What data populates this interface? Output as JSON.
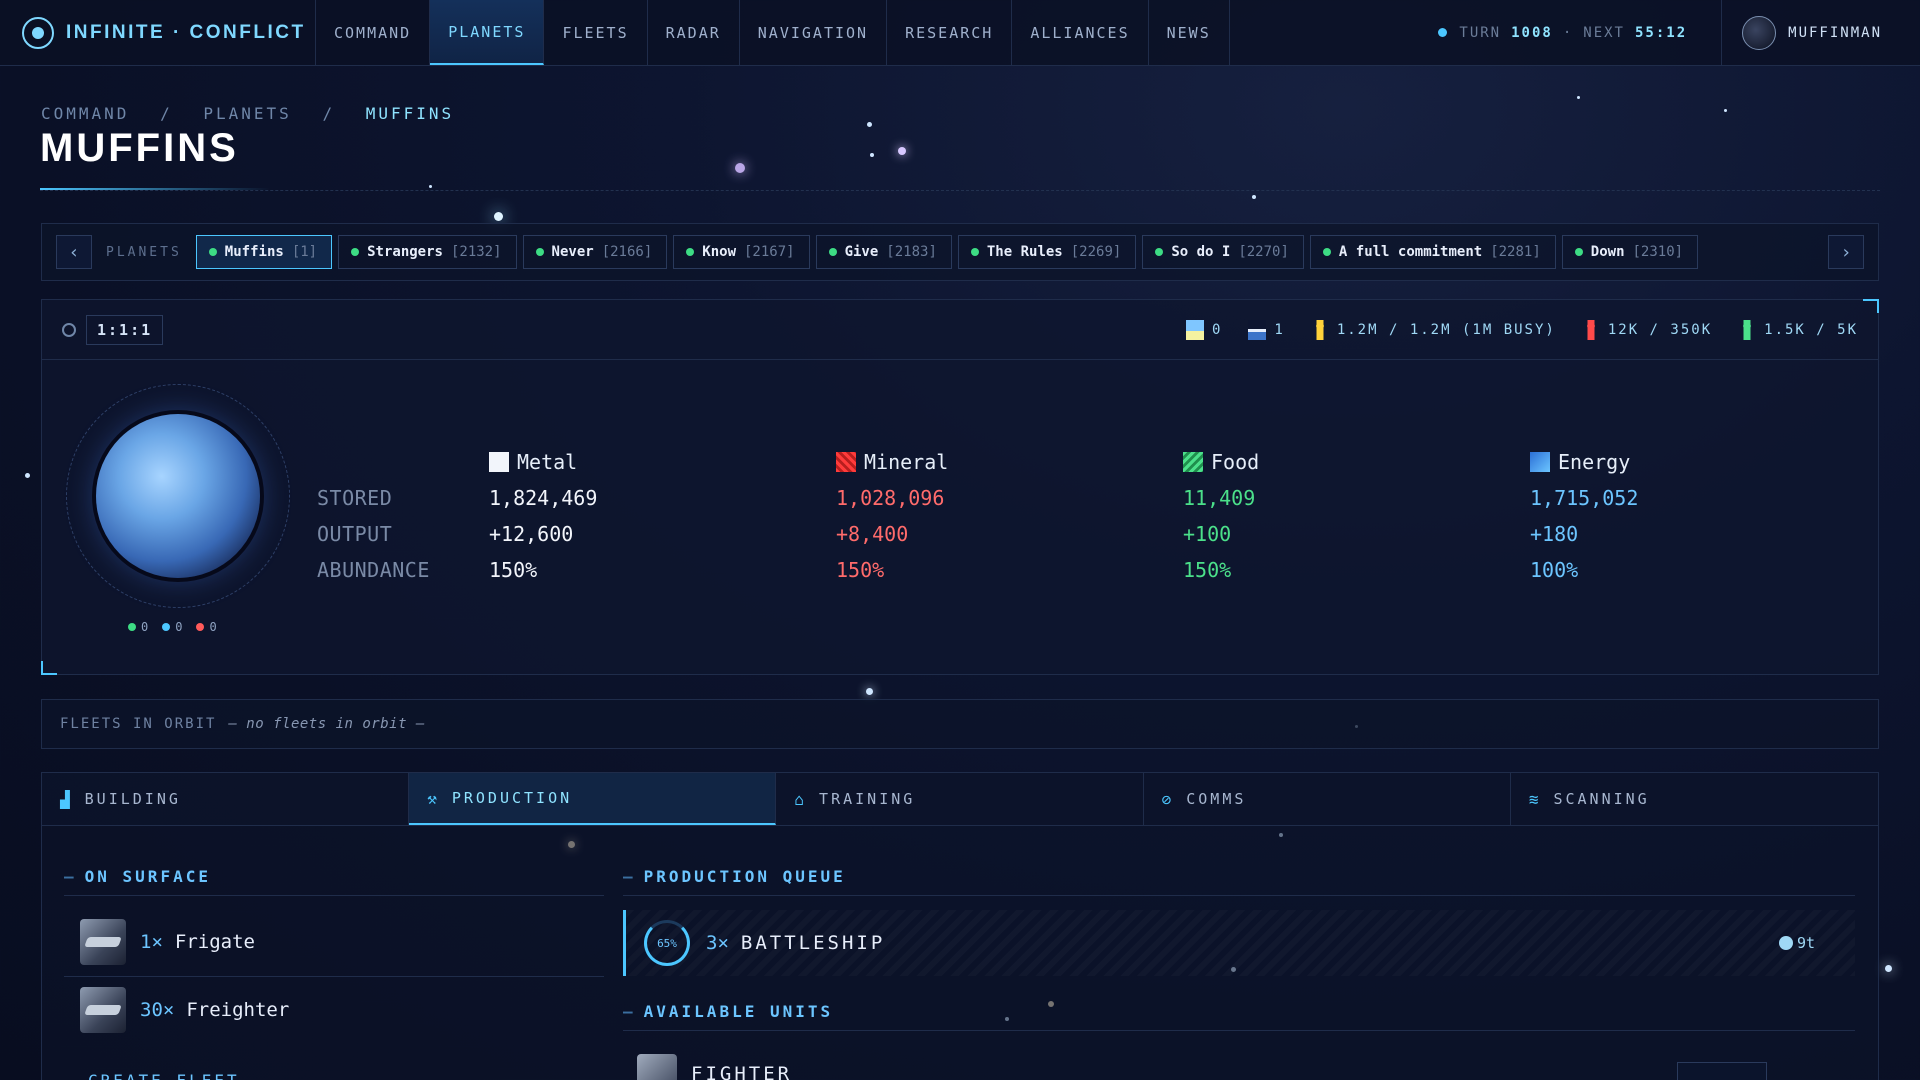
{
  "app": {
    "title": "INFINITE · CONFLICT"
  },
  "nav": {
    "items": [
      "COMMAND",
      "PLANETS",
      "FLEETS",
      "RADAR",
      "NAVIGATION",
      "RESEARCH",
      "ALLIANCES",
      "NEWS"
    ],
    "active": "PLANETS"
  },
  "turn": {
    "label": "TURN",
    "value": "1008",
    "sep": "·",
    "next_label": "NEXT",
    "next_value": "55:12"
  },
  "user": {
    "name": "MUFFINMAN"
  },
  "breadcrumb": {
    "items": [
      "COMMAND",
      "PLANETS",
      "MUFFINS"
    ],
    "sep": "/"
  },
  "page_title": "MUFFINS",
  "planet_strip": {
    "label": "PLANETS",
    "tabs": [
      {
        "name": "Muffins",
        "id": "[1]"
      },
      {
        "name": "Strangers",
        "id": "[2132]"
      },
      {
        "name": "Never",
        "id": "[2166]"
      },
      {
        "name": "Know",
        "id": "[2167]"
      },
      {
        "name": "Give",
        "id": "[2183]"
      },
      {
        "name": "The Rules",
        "id": "[2269]"
      },
      {
        "name": "So do I",
        "id": "[2270]"
      },
      {
        "name": "A full commitment",
        "id": "[2281]"
      },
      {
        "name": "Down",
        "id": "[2310]"
      }
    ],
    "prev_glyph": "‹",
    "next_glyph": "›"
  },
  "planet": {
    "coords": "1:1:1",
    "stats": [
      "0",
      "1",
      "1.2M / 1.2M (1M BUSY)",
      "12K / 350K",
      "1.5K / 5K"
    ],
    "orbit_counts": [
      "0",
      "0",
      "0"
    ],
    "resources": {
      "headers": [
        "Metal",
        "Mineral",
        "Food",
        "Energy"
      ],
      "rows": [
        {
          "label": "STORED",
          "values": [
            "1,824,469",
            "1,028,096",
            "11,409",
            "1,715,052"
          ]
        },
        {
          "label": "OUTPUT",
          "values": [
            "+12,600",
            "+8,400",
            "+100",
            "+180"
          ]
        },
        {
          "label": "ABUNDANCE",
          "values": [
            "150%",
            "150%",
            "150%",
            "100%"
          ]
        }
      ]
    }
  },
  "fleets": {
    "label": "FLEETS IN ORBIT",
    "empty": "— no fleets in orbit —"
  },
  "bottom_tabs": {
    "items": [
      {
        "label": "BUILDING",
        "icon": "factory-icon",
        "glyph": "▟"
      },
      {
        "label": "PRODUCTION",
        "icon": "hammer-icon",
        "glyph": "⚒"
      },
      {
        "label": "TRAINING",
        "icon": "graduation-cap-icon",
        "glyph": "⌂"
      },
      {
        "label": "COMMS",
        "icon": "satellite-icon",
        "glyph": "⊘"
      },
      {
        "label": "SCANNING",
        "icon": "wifi-icon",
        "glyph": "≋"
      }
    ],
    "active": "PRODUCTION"
  },
  "on_surface": {
    "title": "ON SURFACE",
    "units": [
      {
        "count": "1×",
        "name": "Frigate"
      },
      {
        "count": "30×",
        "name": "Freighter"
      }
    ],
    "create_label": "CREATE FLEET"
  },
  "production_queue": {
    "title": "PRODUCTION QUEUE",
    "items": [
      {
        "progress": "65%",
        "progress_value": 65,
        "count": "3×",
        "name": "BATTLESHIP",
        "time": "9t"
      }
    ]
  },
  "available_units": {
    "title": "AVAILABLE UNITS",
    "items": [
      {
        "name": "FIGHTER"
      }
    ]
  },
  "colors": {
    "accent": "#4cc7ff",
    "metal": "#f2f5fb",
    "mineral": "#ff6b6b",
    "food": "#4be08a",
    "energy": "#6cc5ff"
  }
}
